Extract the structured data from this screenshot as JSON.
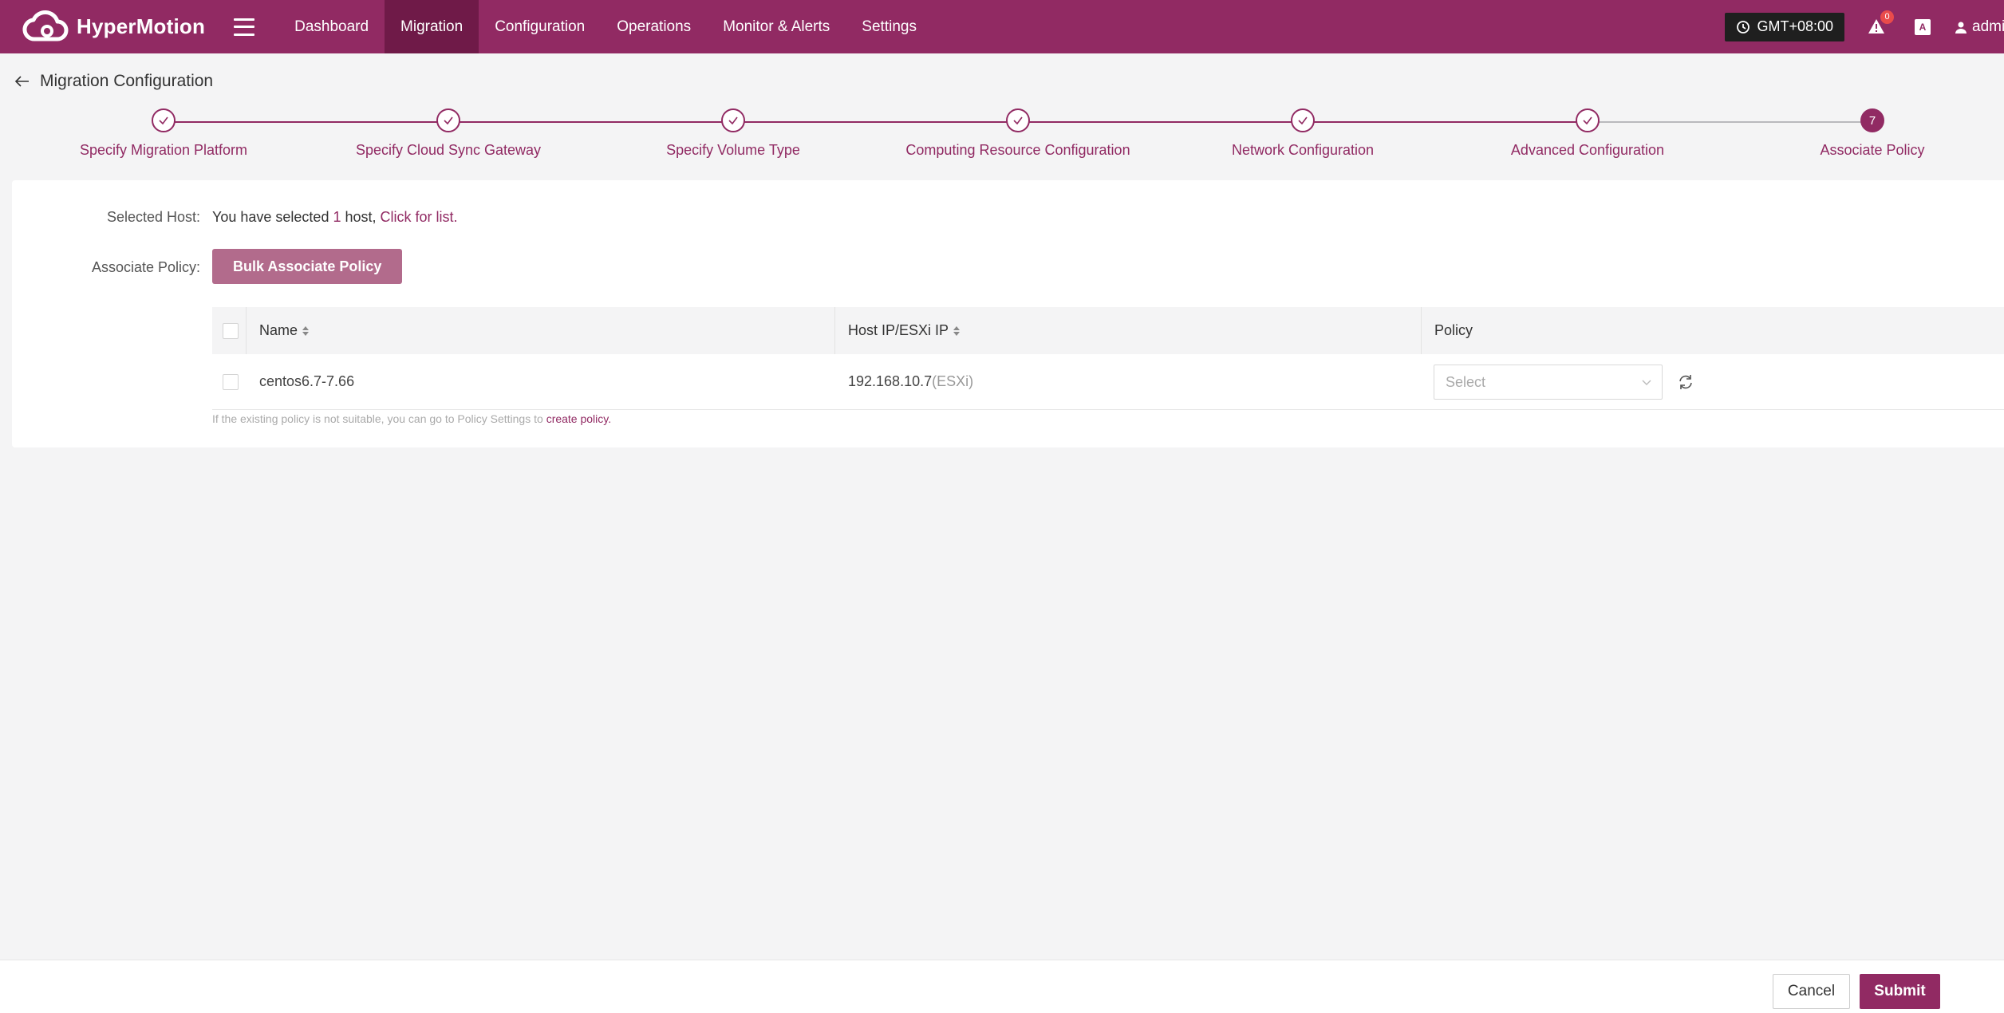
{
  "app": {
    "brand": "HyperMotion"
  },
  "nav": {
    "items": [
      {
        "label": "Dashboard"
      },
      {
        "label": "Migration",
        "active": true
      },
      {
        "label": "Configuration"
      },
      {
        "label": "Operations"
      },
      {
        "label": "Monitor & Alerts"
      },
      {
        "label": "Settings"
      }
    ]
  },
  "topright": {
    "timezone": "GMT+08:00",
    "alert_count": "0",
    "lang_glyph": "A",
    "user": "admin"
  },
  "page": {
    "title": "Migration Configuration"
  },
  "steps": {
    "current": 7,
    "items": [
      {
        "label": "Specify Migration Platform",
        "status": "done"
      },
      {
        "label": "Specify Cloud Sync Gateway",
        "status": "done"
      },
      {
        "label": "Specify Volume Type",
        "status": "done"
      },
      {
        "label": "Computing Resource Configuration",
        "status": "done"
      },
      {
        "label": "Network Configuration",
        "status": "done"
      },
      {
        "label": "Advanced Configuration",
        "status": "done"
      },
      {
        "label": "Associate Policy",
        "status": "current",
        "number": "7"
      }
    ]
  },
  "form": {
    "selected_host_label": "Selected Host:",
    "selected_prefix": "You have selected ",
    "selected_count": "1",
    "selected_unit": " host, ",
    "click_for_list": "Click for list",
    "selected_suffix": ".",
    "associate_policy_label": "Associate Policy:",
    "bulk_button": "Bulk Associate Policy"
  },
  "table": {
    "headers": {
      "name": "Name",
      "ip": "Host IP/ESXi IP",
      "policy": "Policy"
    },
    "rows": [
      {
        "name": "centos6.7-7.66",
        "ip": "192.168.10.7",
        "ip_type": "(ESXi)",
        "policy_placeholder": "Select"
      }
    ]
  },
  "hint": {
    "text": "If the existing policy is not suitable, you can go to Policy Settings to ",
    "link": "create policy",
    "suffix": "."
  },
  "footer": {
    "cancel": "Cancel",
    "submit": "Submit"
  },
  "colors": {
    "accent": "#912a63",
    "accent_dark": "#6f1a48",
    "button_muted": "#b26b8c"
  }
}
